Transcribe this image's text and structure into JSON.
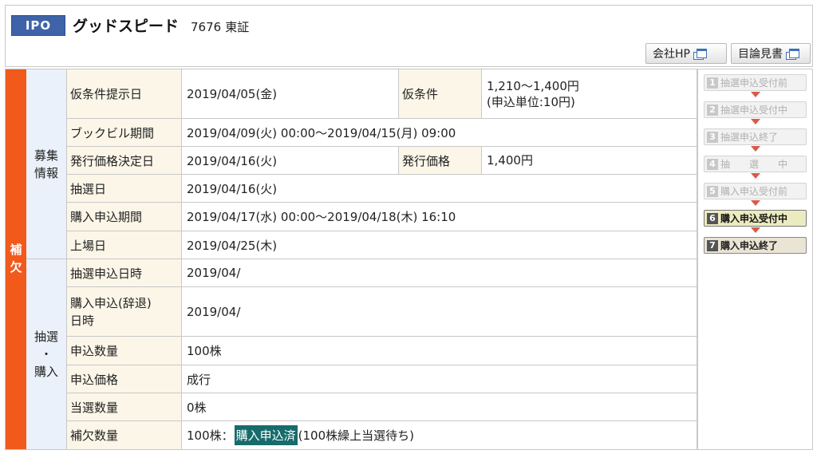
{
  "header": {
    "badge": "IPO",
    "company_name": "グッドスピード",
    "code": "7676",
    "market": "東証",
    "hp_button": "会社HP",
    "prospectus_button": "目論見書"
  },
  "status_side_label": [
    "補",
    "欠"
  ],
  "sections": {
    "recruit": [
      "募集",
      "情報"
    ],
    "lottery": [
      "抽選",
      "・",
      "購入"
    ]
  },
  "rows": {
    "provisional_date": {
      "label": "仮条件提示日",
      "value": "2019/04/05(金)",
      "label2": "仮条件",
      "value2_line1": "1,210～1,400円",
      "value2_line2": "(申込単位:10円)"
    },
    "bookbuild": {
      "label": "ブックビル期間",
      "value": "2019/04/09(火) 00:00～2019/04/15(月) 09:00"
    },
    "price_decision": {
      "label": "発行価格決定日",
      "value": "2019/04/16(火)",
      "label2": "発行価格",
      "value2": "1,400円"
    },
    "lottery_date": {
      "label": "抽選日",
      "value": "2019/04/16(火)"
    },
    "purchase_period": {
      "label": "購入申込期間",
      "value": "2019/04/17(水) 00:00～2019/04/18(木) 16:10"
    },
    "listing_date": {
      "label": "上場日",
      "value": "2019/04/25(木)"
    },
    "lottery_apply_dt": {
      "label": "抽選申込日時",
      "value": "2019/04/"
    },
    "purchase_apply_dt": {
      "label_line1": "購入申込(辞退)",
      "label_line2": "日時",
      "value": "2019/04/"
    },
    "apply_qty": {
      "label": "申込数量",
      "value": "100株"
    },
    "apply_price": {
      "label": "申込価格",
      "value": "成行"
    },
    "won_qty": {
      "label": "当選数量",
      "value": "0株"
    },
    "reserve_qty": {
      "label": "補欠数量",
      "value_prefix": "100株：",
      "highlight": "購入申込済",
      "value_suffix": "(100株繰上当選待ち)"
    }
  },
  "steps": [
    {
      "num": "1",
      "label": "抽選申込受付前"
    },
    {
      "num": "2",
      "label": "抽選申込受付中"
    },
    {
      "num": "3",
      "label": "抽選申込終了"
    },
    {
      "num": "4",
      "label": "抽　　選　　中"
    },
    {
      "num": "5",
      "label": "購入申込受付前"
    },
    {
      "num": "6",
      "label": "購入申込受付中"
    },
    {
      "num": "7",
      "label": "購入申込終了"
    }
  ],
  "colors": {
    "accent_orange": "#f25a1c",
    "highlight_teal": "#176b6b",
    "badge_blue": "#3f63a8"
  }
}
